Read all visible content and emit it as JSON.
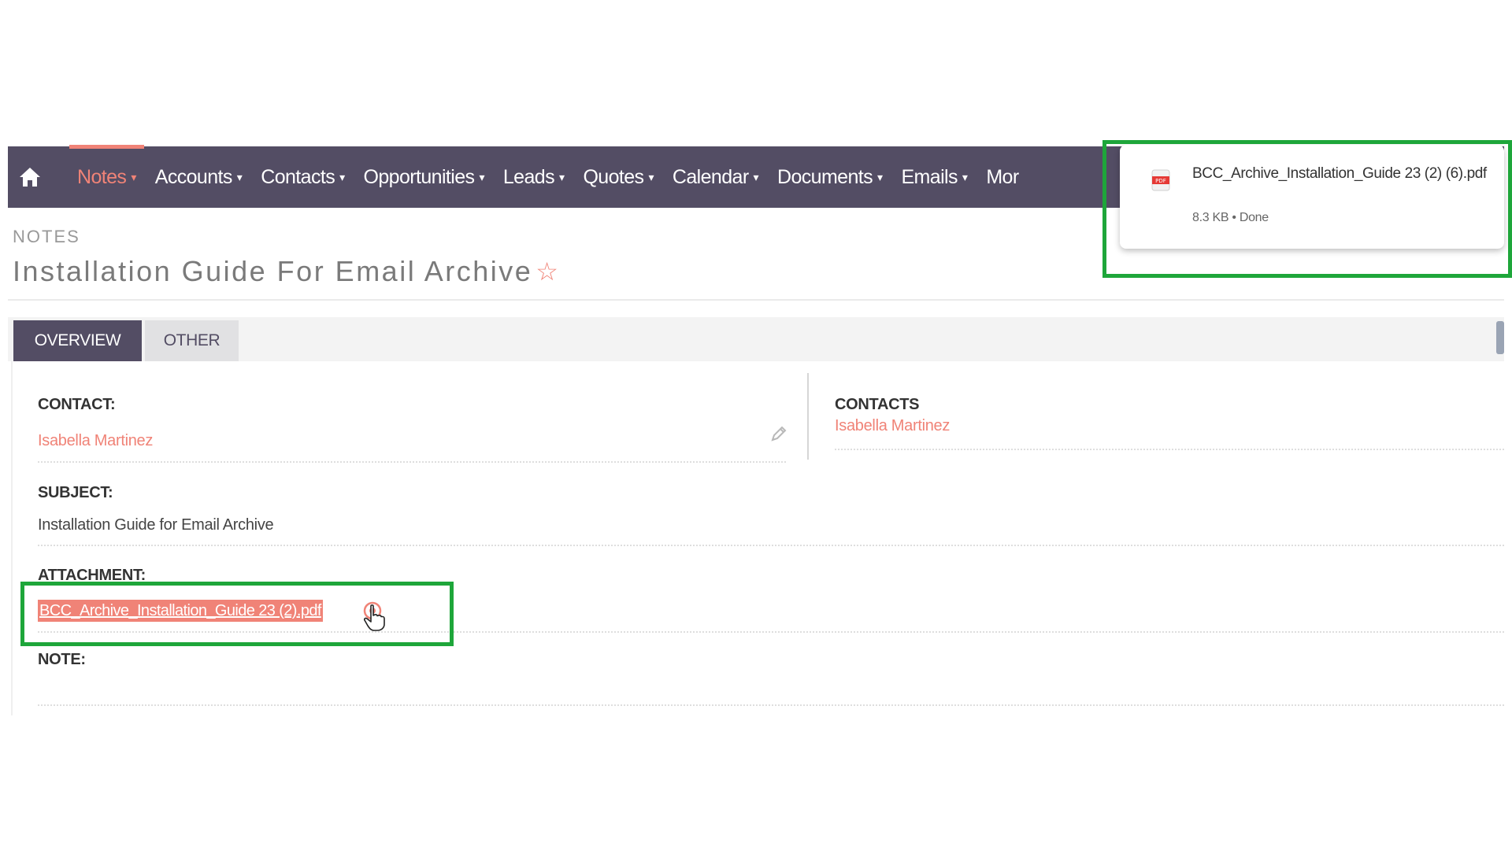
{
  "nav": {
    "items": [
      {
        "label": "Notes",
        "caret": "▾"
      },
      {
        "label": "Accounts",
        "caret": "▾"
      },
      {
        "label": "Contacts",
        "caret": "▾"
      },
      {
        "label": "Opportunities",
        "caret": "▾"
      },
      {
        "label": "Leads",
        "caret": "▾"
      },
      {
        "label": "Quotes",
        "caret": "▾"
      },
      {
        "label": "Calendar",
        "caret": "▾"
      },
      {
        "label": "Documents",
        "caret": "▾"
      },
      {
        "label": "Emails",
        "caret": "▾"
      }
    ],
    "more_label": "Mor",
    "home_icon": "home-icon"
  },
  "header": {
    "module": "NOTES",
    "title": "Installation Guide For Email Archive",
    "star": "☆"
  },
  "tabs": {
    "overview": "OVERVIEW",
    "other": "OTHER"
  },
  "fields": {
    "contact_label": "CONTACT:",
    "contact_value": "Isabella Martinez",
    "subject_label": "SUBJECT:",
    "subject_value": "Installation Guide for Email Archive",
    "attachment_label": "ATTACHMENT:",
    "attachment_value": "BCC_Archive_Installation_Guide 23 (2).pdf",
    "note_label": "NOTE:"
  },
  "side": {
    "contacts_label": "CONTACTS",
    "contacts_value": "Isabella Martinez"
  },
  "download": {
    "filename": "BCC_Archive_Installation_Guide 23 (2) (6).pdf",
    "meta": "8.3 KB • Done",
    "icon": "pdf-file-icon"
  },
  "colors": {
    "nav_bg": "#534d64",
    "accent": "#f08377",
    "highlight_box": "#1ea63a"
  }
}
